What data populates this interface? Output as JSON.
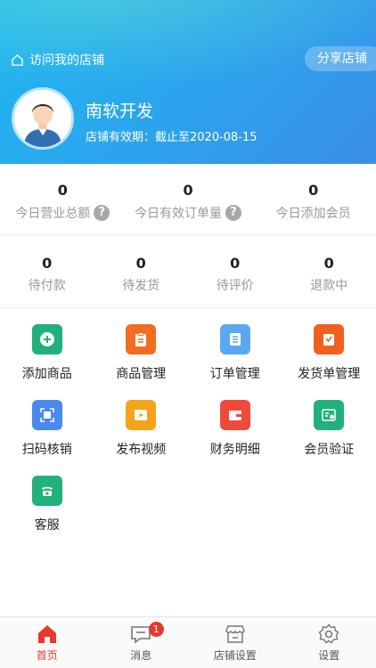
{
  "header": {
    "visit_label": "访问我的店铺",
    "share_label": "分享店铺",
    "shop_name": "南软开发",
    "valid_text": "店铺有效期：截止至2020-08-15"
  },
  "stats_top": [
    {
      "value": "0",
      "label": "今日营业总额",
      "help": "?"
    },
    {
      "value": "0",
      "label": "今日有效订单量",
      "help": "?"
    },
    {
      "value": "0",
      "label": "今日添加会员"
    }
  ],
  "stats_orders": [
    {
      "value": "0",
      "label": "待付款"
    },
    {
      "value": "0",
      "label": "待发货"
    },
    {
      "value": "0",
      "label": "待评价"
    },
    {
      "value": "0",
      "label": "退款中"
    }
  ],
  "menu": [
    {
      "label": "添加商品",
      "icon": "plus-circle-icon",
      "color": "#22b07d"
    },
    {
      "label": "商品管理",
      "icon": "clipboard-icon",
      "color": "#f26d21"
    },
    {
      "label": "订单管理",
      "icon": "list-icon",
      "color": "#5aa9f0"
    },
    {
      "label": "发货单管理",
      "icon": "shipping-icon",
      "color": "#f2601f"
    },
    {
      "label": "扫码核销",
      "icon": "scan-icon",
      "color": "#4a8af0"
    },
    {
      "label": "发布视频",
      "icon": "video-icon",
      "color": "#f5a31a"
    },
    {
      "label": "财务明细",
      "icon": "wallet-icon",
      "color": "#ee4a3a"
    },
    {
      "label": "会员验证",
      "icon": "member-card-icon",
      "color": "#22b07d"
    },
    {
      "label": "客服",
      "icon": "phone-icon",
      "color": "#22b07d"
    }
  ],
  "tabbar": [
    {
      "label": "首页",
      "icon": "home-icon",
      "active": true
    },
    {
      "label": "消息",
      "icon": "message-icon",
      "badge": "1"
    },
    {
      "label": "店铺设置",
      "icon": "store-icon"
    },
    {
      "label": "设置",
      "icon": "gear-icon"
    }
  ],
  "colors": {
    "accent": "#e8382c",
    "header_start": "#1fb8f0",
    "header_end": "#3b8fe6"
  }
}
